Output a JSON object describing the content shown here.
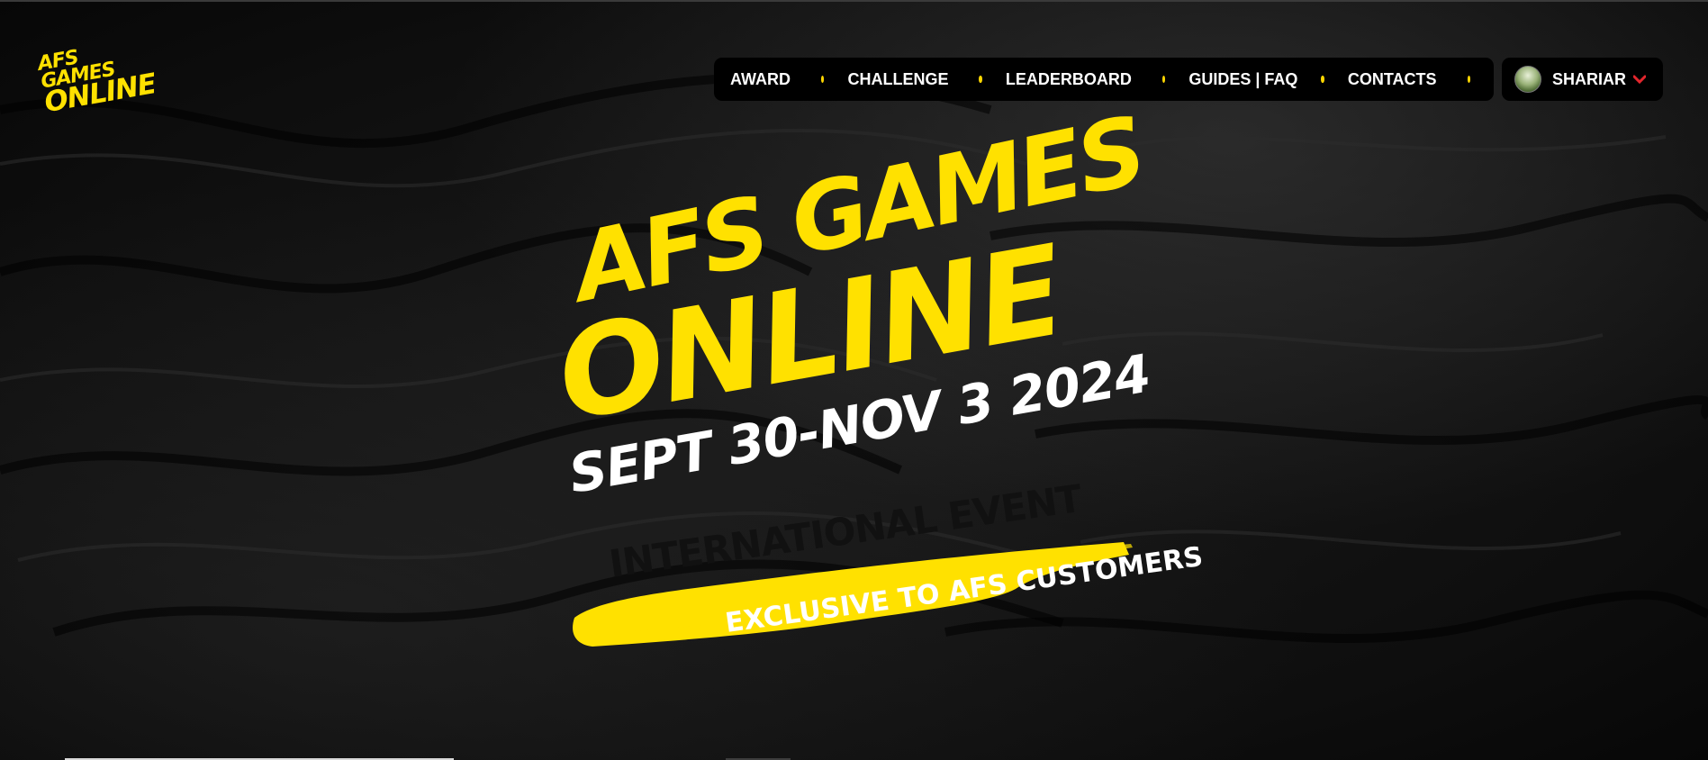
{
  "logo": {
    "line1": "AFS GAMES",
    "line2": "ONLINE"
  },
  "nav": {
    "items": [
      {
        "label": "AWARD"
      },
      {
        "label": "CHALLENGE"
      },
      {
        "label": "LEADERBOARD"
      },
      {
        "label": "GUIDES | FAQ"
      },
      {
        "label": "CONTACTS"
      }
    ]
  },
  "user": {
    "name": "SHARIAR"
  },
  "hero": {
    "title_line1": "AFS GAMES",
    "title_line2": "ONLINE",
    "dates": "SEPT 30-NOV 3 2024",
    "event": "INTERNATIONAL EVENT",
    "exclusive": "EXCLUSIVE TO AFS CUSTOMERS"
  },
  "colors": {
    "accent": "#ffe100",
    "nav_background": "#000000",
    "chevron": "#e3262d",
    "background": "#111111"
  }
}
